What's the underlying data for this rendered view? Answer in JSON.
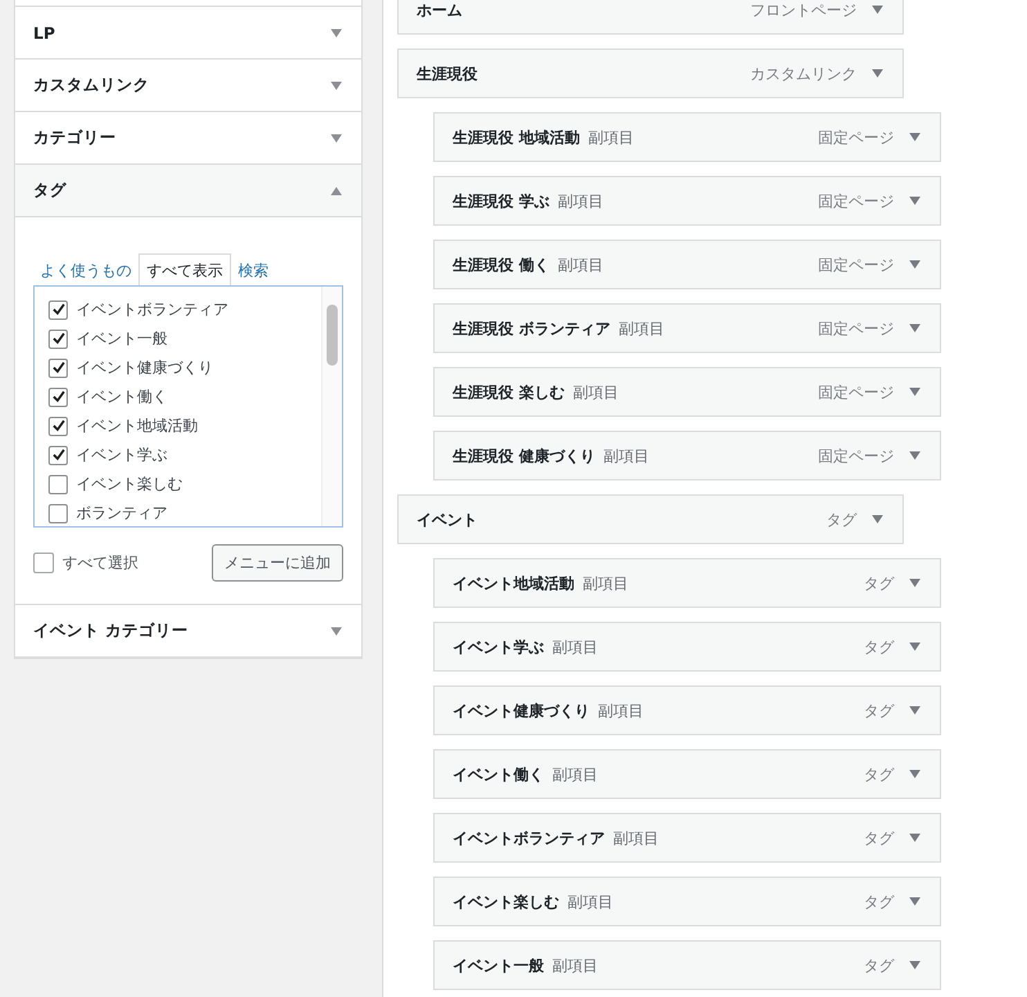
{
  "sidebar": {
    "sections": [
      {
        "title": "LP",
        "expanded": false
      },
      {
        "title": "カスタムリンク",
        "expanded": false
      },
      {
        "title": "カテゴリー",
        "expanded": false
      },
      {
        "title": "タグ",
        "expanded": true
      },
      {
        "title": "イベント カテゴリー",
        "expanded": false
      }
    ],
    "tag_panel": {
      "tabs": [
        {
          "label": "よく使うもの",
          "selected": false
        },
        {
          "label": "すべて表示",
          "selected": true
        },
        {
          "label": "検索",
          "selected": false
        }
      ],
      "items": [
        {
          "label": "イベントボランティア",
          "checked": true
        },
        {
          "label": "イベント一般",
          "checked": true
        },
        {
          "label": "イベント健康づくり",
          "checked": true
        },
        {
          "label": "イベント働く",
          "checked": true
        },
        {
          "label": "イベント地域活動",
          "checked": true
        },
        {
          "label": "イベント学ぶ",
          "checked": true
        },
        {
          "label": "イベント楽しむ",
          "checked": false
        },
        {
          "label": "ボランティア",
          "checked": false
        }
      ],
      "select_all": {
        "label": "すべて選択",
        "checked": false
      },
      "add_button": "メニューに追加"
    }
  },
  "menu": {
    "items": [
      {
        "title": "ホーム",
        "type": "フロントページ"
      },
      {
        "title": "生涯現役",
        "type": "カスタムリンク",
        "children": [
          {
            "title": "生涯現役 地域活動",
            "sub": "副項目",
            "type": "固定ページ"
          },
          {
            "title": "生涯現役 学ぶ",
            "sub": "副項目",
            "type": "固定ページ"
          },
          {
            "title": "生涯現役 働く",
            "sub": "副項目",
            "type": "固定ページ"
          },
          {
            "title": "生涯現役 ボランティア",
            "sub": "副項目",
            "type": "固定ページ"
          },
          {
            "title": "生涯現役 楽しむ",
            "sub": "副項目",
            "type": "固定ページ"
          },
          {
            "title": "生涯現役 健康づくり",
            "sub": "副項目",
            "type": "固定ページ"
          }
        ]
      },
      {
        "title": "イベント",
        "type": "タグ",
        "children": [
          {
            "title": "イベント地域活動",
            "sub": "副項目",
            "type": "タグ"
          },
          {
            "title": "イベント学ぶ",
            "sub": "副項目",
            "type": "タグ"
          },
          {
            "title": "イベント健康づくり",
            "sub": "副項目",
            "type": "タグ"
          },
          {
            "title": "イベント働く",
            "sub": "副項目",
            "type": "タグ"
          },
          {
            "title": "イベントボランティア",
            "sub": "副項目",
            "type": "タグ"
          },
          {
            "title": "イベント楽しむ",
            "sub": "副項目",
            "type": "タグ"
          },
          {
            "title": "イベント一般",
            "sub": "副項目",
            "type": "タグ"
          }
        ]
      }
    ]
  }
}
